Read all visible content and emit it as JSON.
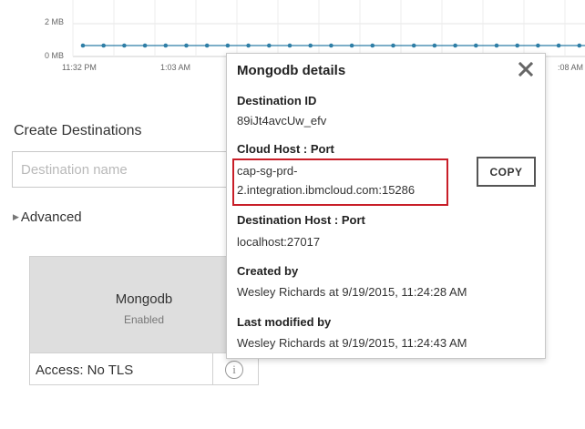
{
  "chart": {
    "y_labels": [
      "2 MB",
      "0 MB"
    ],
    "x_labels": [
      "11:32 PM",
      "1:03 AM",
      ":08 AM"
    ],
    "series_color": "#2e7ea6"
  },
  "create": {
    "title": "Create Destinations",
    "name_placeholder": "Destination name",
    "advanced_label": "Advanced"
  },
  "card": {
    "name": "Mongodb",
    "status": "Enabled",
    "access": "Access: No TLS"
  },
  "popup": {
    "title": "Mongodb details",
    "destination_id_label": "Destination ID",
    "destination_id": "89iJt4avcUw_efv",
    "cloud_host_label": "Cloud Host : Port",
    "cloud_host_line1": "cap-sg-prd-",
    "cloud_host_line2": "2.integration.ibmcloud.com:15286",
    "copy_label": "COPY",
    "dest_host_label": "Destination Host : Port",
    "dest_host": "localhost:27017",
    "created_label": "Created by",
    "created": "Wesley Richards at 9/19/2015, 11:24:28 AM",
    "modified_label": "Last modified by",
    "modified": "Wesley Richards at 9/19/2015, 11:24:43 AM",
    "highlight_color": "#c81e28"
  }
}
